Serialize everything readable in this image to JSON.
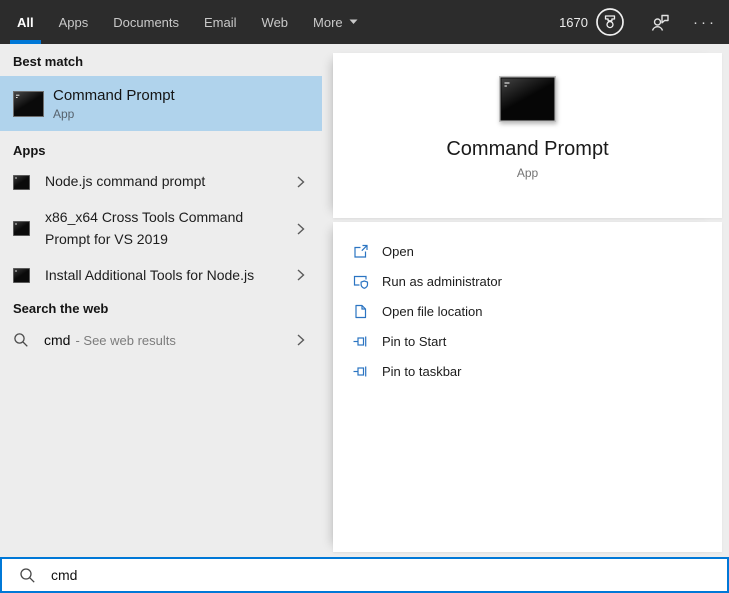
{
  "header": {
    "tabs": [
      {
        "label": "All"
      },
      {
        "label": "Apps"
      },
      {
        "label": "Documents"
      },
      {
        "label": "Email"
      },
      {
        "label": "Web"
      },
      {
        "label": "More"
      }
    ],
    "rewards_count": "1670",
    "more_menu": "···"
  },
  "left_panel": {
    "best_match": {
      "header": "Best match",
      "item": {
        "title": "Command Prompt",
        "subtitle": "App"
      }
    },
    "apps": {
      "header": "Apps",
      "items": [
        {
          "title": "Node.js command prompt"
        },
        {
          "title": "x86_x64 Cross Tools Command Prompt for VS 2019"
        },
        {
          "title": "Install Additional Tools for Node.js"
        }
      ]
    },
    "search_web": {
      "header": "Search the web",
      "item": {
        "query": "cmd",
        "suffix": "- See web results"
      }
    }
  },
  "preview_panel": {
    "app_title": "Command Prompt",
    "app_type": "App",
    "actions": [
      {
        "label": "Open",
        "icon": "open-icon"
      },
      {
        "label": "Run as administrator",
        "icon": "admin-shield-icon"
      },
      {
        "label": "Open file location",
        "icon": "file-location-icon"
      },
      {
        "label": "Pin to Start",
        "icon": "pin-icon"
      },
      {
        "label": "Pin to taskbar",
        "icon": "pin-icon"
      }
    ]
  },
  "search_bar": {
    "value": "cmd"
  },
  "icons": {
    "rewards": "medal-in-circle",
    "feedback": "person-with-speech-bubble",
    "app": "terminal-window",
    "chevron": "chevron-right",
    "search": "magnifier"
  },
  "colors": {
    "accent": "#0078d7",
    "topbar_bg": "#2c2c2c",
    "best_match_highlight": "#b0d3ec",
    "panel_bg": "#ededed",
    "action_icon_blue": "#2b74c2"
  }
}
